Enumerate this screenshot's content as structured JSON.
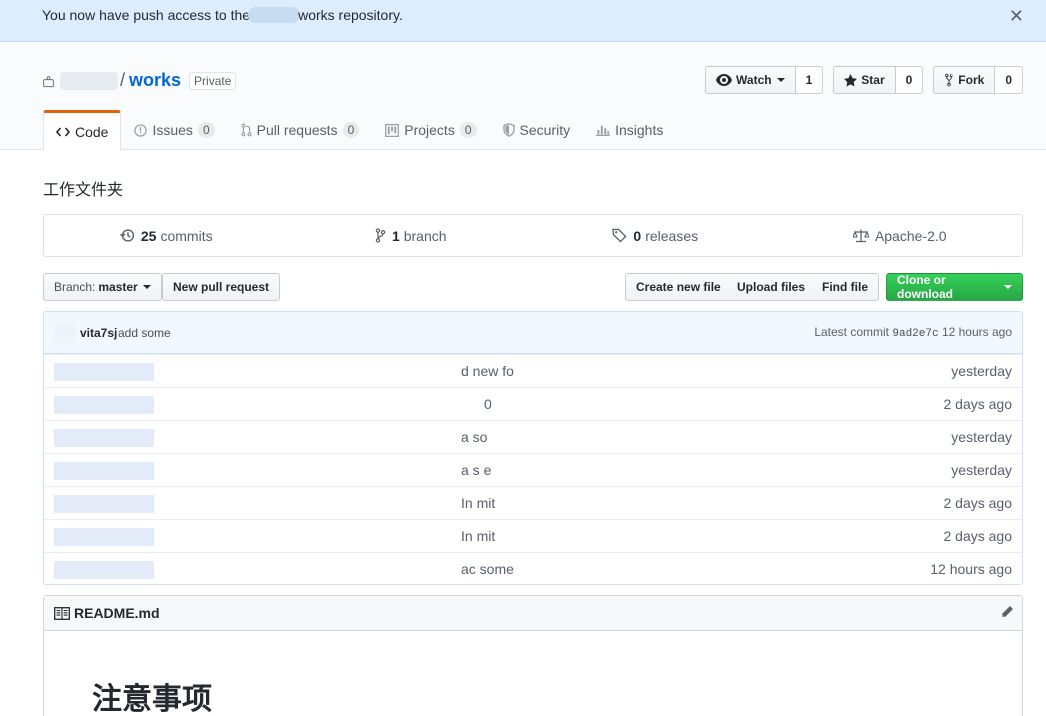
{
  "flash": {
    "message_before": "You now have push access to the",
    "message_after": "works repository.",
    "close_glyph": "✕"
  },
  "repo": {
    "slash": "/",
    "name": "works",
    "visibility": "Private"
  },
  "actions": {
    "watch_label": "Watch",
    "watch_count": "1",
    "star_label": "Star",
    "star_count": "0",
    "fork_label": "Fork",
    "fork_count": "0"
  },
  "tabs": [
    {
      "label": "Code",
      "icon": "code-icon"
    },
    {
      "label": "Issues",
      "count": "0",
      "icon": "issue-icon"
    },
    {
      "label": "Pull requests",
      "count": "0",
      "icon": "pull-request-icon"
    },
    {
      "label": "Projects",
      "count": "0",
      "icon": "project-icon"
    },
    {
      "label": "Security",
      "icon": "shield-icon"
    },
    {
      "label": "Insights",
      "icon": "graph-icon"
    }
  ],
  "description": "工作文件夹",
  "summary": {
    "commits_num": "25",
    "commits_label": "commits",
    "branch_num": "1",
    "branch_label": "branch",
    "releases_num": "0",
    "releases_label": "releases",
    "license": "Apache-2.0"
  },
  "filebar": {
    "branch_prefix": "Branch:",
    "branch_name": "master",
    "new_pr": "New pull request",
    "create_file": "Create new file",
    "upload_files": "Upload files",
    "find_file": "Find file",
    "clone": "Clone or download"
  },
  "commit": {
    "author": "vita7sj",
    "message": "add some",
    "latest_label": "Latest commit",
    "sha": "9ad2e7c",
    "age": "12 hours ago"
  },
  "files": [
    {
      "message": "d new  fo",
      "age": "yesterday"
    },
    {
      "message": "0",
      "age": "2 days ago"
    },
    {
      "message": "a   so",
      "age": "yesterday"
    },
    {
      "message": "a    s        e",
      "age": "yesterday"
    },
    {
      "message": "In          mit",
      "age": "2 days ago"
    },
    {
      "message": "In          mit",
      "age": "2 days ago"
    },
    {
      "message": "ac  some",
      "age": "12 hours ago"
    }
  ],
  "readme": {
    "filename": "README.md",
    "heading": "注意事项"
  },
  "colors": {
    "accent": "#0366d6",
    "tab_underline": "#e36209",
    "clone_green": "#28a745",
    "flash_bg": "#dbedff"
  }
}
